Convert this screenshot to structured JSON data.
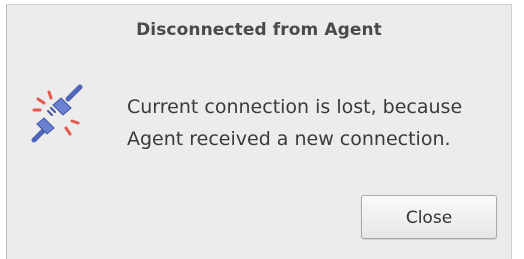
{
  "dialog": {
    "title": "Disconnected from Agent",
    "message_line1": "Current connection is lost, because",
    "message_line2": "Agent received a new connection.",
    "icon": "disconnected-plug-icon",
    "close_label": "Close"
  },
  "colors": {
    "background": "#ececec",
    "plug_blue": "#5b72c4",
    "spark_red": "#e25b4e"
  }
}
